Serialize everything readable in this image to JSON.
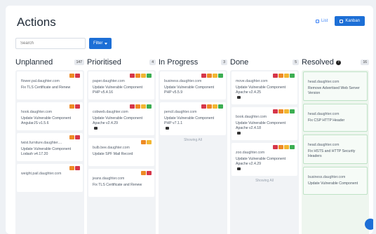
{
  "page": {
    "title": "Actions"
  },
  "view": {
    "list_label": "List",
    "kanban_label": "Kanban"
  },
  "search": {
    "placeholder": "Search"
  },
  "filter": {
    "label": "Filter"
  },
  "columns": [
    {
      "title": "Unplanned",
      "count": "147",
      "cards": [
        {
          "host": "flower.pal.daughter.com",
          "text": "Fix TLS Certificate and Renew"
        },
        {
          "host": "hook.daughter.com",
          "text": "Update Vulnerable Component AngularJS v1.5.6"
        },
        {
          "host": "twist.furniture.daughter....",
          "text": "Update Vulnerable Component Lodash v4.17.20"
        },
        {
          "host": "weight.pail.daughter.com",
          "text": ""
        }
      ]
    },
    {
      "title": "Prioritised",
      "count": "4",
      "cards": [
        {
          "host": "paper.daughter.com",
          "text": "Update Vulnerable Component PHP v5.4.16"
        },
        {
          "host": "cobweb.daughter.com",
          "text": "Update Vulnerable Component Apache v2.4.29"
        },
        {
          "host": "bulb.bee.daughter.com",
          "text": "Update SPF Mail Record"
        },
        {
          "host": "jeans.daughter.com",
          "text": "Fix TLS Certificate and Renew"
        }
      ]
    },
    {
      "title": "In Progress",
      "count": "3",
      "cards": [
        {
          "host": "business.daughter.com",
          "text": "Update Vulnerable Component PHP v5.5.9"
        },
        {
          "host": "pencil.daughter.com",
          "text": "Update Vulnerable Component PHP v7.1.1"
        }
      ],
      "footer": "Showing All"
    },
    {
      "title": "Done",
      "count": "5",
      "cards": [
        {
          "host": "move.daughter.com",
          "text": "Update Vulnerable Component Apache v2.4.25"
        },
        {
          "host": "book.daughter.com",
          "text": "Update Vulnerable Component Apache v2.4.18"
        },
        {
          "host": "zoo.daughter.com",
          "text": "Update Vulnerable Component Apache v2.4.29"
        }
      ],
      "footer": "Showing All"
    },
    {
      "title": "Resolved",
      "count": "16",
      "cards": [
        {
          "host": "head.daughter.com",
          "text": "Remove Advertised Web Server Version"
        },
        {
          "host": "head.daughter.com",
          "text": "Fix CSP HTTP Header"
        },
        {
          "host": "head.daughter.com",
          "text": "Fix HSTS and HTTP Security Headers"
        },
        {
          "host": "business.daughter.com",
          "text": "Update Vulnerable Component"
        }
      ]
    }
  ],
  "colors": {
    "accent": "#1d6fd6",
    "red": "#d6364a",
    "orange": "#ee8a24",
    "yellow": "#f2b632",
    "green": "#3cae52"
  }
}
